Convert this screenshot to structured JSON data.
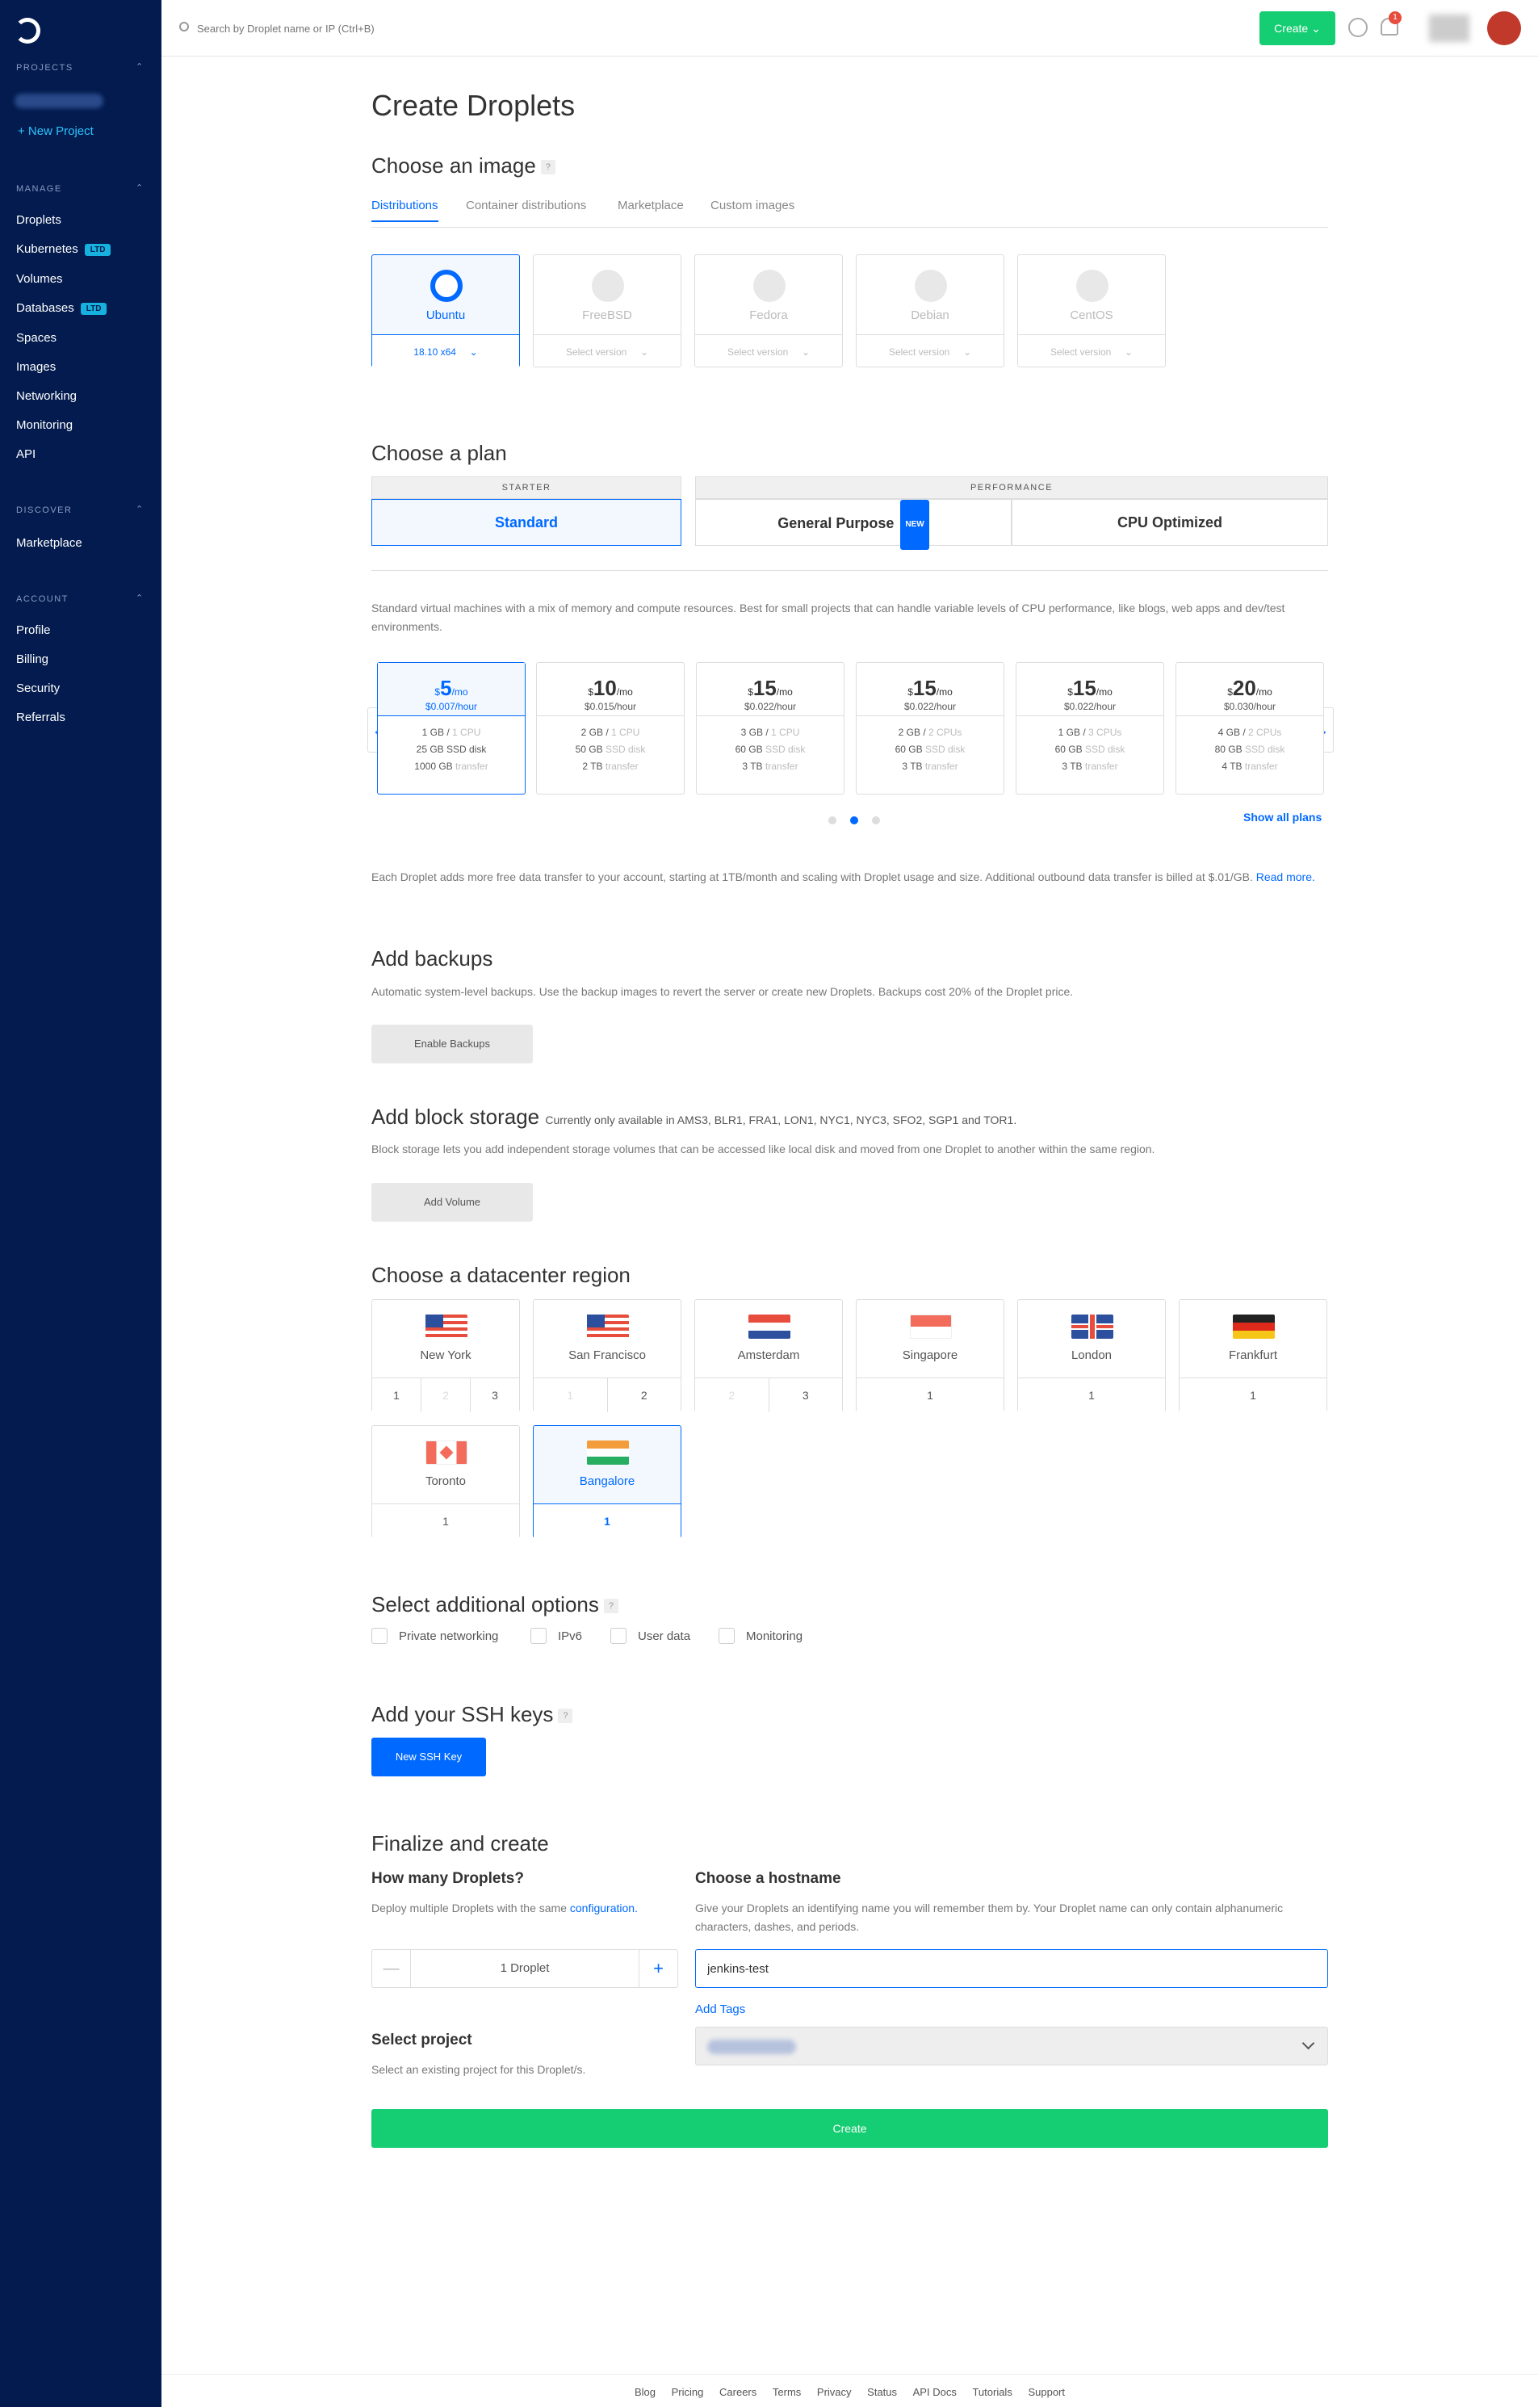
{
  "sidebar": {
    "projects_label": "PROJECTS",
    "new_project": "+  New Project",
    "manage_label": "MANAGE",
    "manage_items": [
      {
        "label": "Droplets",
        "badge": ""
      },
      {
        "label": "Kubernetes",
        "badge": "LTD"
      },
      {
        "label": "Volumes",
        "badge": ""
      },
      {
        "label": "Databases",
        "badge": "LTD"
      },
      {
        "label": "Spaces",
        "badge": ""
      },
      {
        "label": "Images",
        "badge": ""
      },
      {
        "label": "Networking",
        "badge": ""
      },
      {
        "label": "Monitoring",
        "badge": ""
      },
      {
        "label": "API",
        "badge": ""
      }
    ],
    "discover_label": "DISCOVER",
    "discover_items": [
      "Marketplace"
    ],
    "account_label": "ACCOUNT",
    "account_items": [
      "Profile",
      "Billing",
      "Security",
      "Referrals"
    ]
  },
  "topbar": {
    "search_placeholder": "Search by Droplet name or IP (Ctrl+B)",
    "create_label": "Create",
    "notification_count": "1"
  },
  "page_title": "Create Droplets",
  "image_section": {
    "title": "Choose an image",
    "help": "?",
    "tabs": [
      "Distributions",
      "Container distributions",
      "Marketplace",
      "Custom images"
    ],
    "distros": [
      {
        "name": "Ubuntu",
        "version": "18.10 x64"
      },
      {
        "name": "FreeBSD",
        "version": "Select version"
      },
      {
        "name": "Fedora",
        "version": "Select version"
      },
      {
        "name": "Debian",
        "version": "Select version"
      },
      {
        "name": "CentOS",
        "version": "Select version"
      }
    ]
  },
  "plan_section": {
    "title": "Choose a plan",
    "starter_label": "STARTER",
    "performance_label": "PERFORMANCE",
    "standard": "Standard",
    "general_purpose": "General Purpose",
    "new_badge": "NEW",
    "cpu_optimized": "CPU Optimized",
    "description": "Standard virtual machines with a mix of memory and compute resources. Best for small projects that can handle variable levels of CPU performance, like blogs, web apps and dev/test environments.",
    "plans": [
      {
        "price": "5",
        "hourly": "$0.007/hour",
        "mem": "1 GB",
        "cpu": "1 CPU",
        "disk": "25 GB",
        "transfer": "1000 GB"
      },
      {
        "price": "10",
        "hourly": "$0.015/hour",
        "mem": "2 GB",
        "cpu": "1 CPU",
        "disk": "50 GB",
        "transfer": "2 TB"
      },
      {
        "price": "15",
        "hourly": "$0.022/hour",
        "mem": "3 GB",
        "cpu": "1 CPU",
        "disk": "60 GB",
        "transfer": "3 TB"
      },
      {
        "price": "15",
        "hourly": "$0.022/hour",
        "mem": "2 GB",
        "cpu": "2 CPUs",
        "disk": "60 GB",
        "transfer": "3 TB"
      },
      {
        "price": "15",
        "hourly": "$0.022/hour",
        "mem": "1 GB",
        "cpu": "3 CPUs",
        "disk": "60 GB",
        "transfer": "3 TB"
      },
      {
        "price": "20",
        "hourly": "$0.030/hour",
        "mem": "4 GB",
        "cpu": "2 CPUs",
        "disk": "80 GB",
        "transfer": "4 TB"
      }
    ],
    "show_all": "Show all plans",
    "transfer_note": "Each Droplet adds more free data transfer to your account, starting at 1TB/month and scaling with Droplet usage and size. Additional outbound data transfer is billed at $.01/GB.",
    "read_more": "Read more."
  },
  "backups": {
    "title": "Add backups",
    "description": "Automatic system-level backups. Use the backup images to revert the server or create new Droplets. Backups cost 20% of the Droplet price.",
    "button": "Enable Backups"
  },
  "block_storage": {
    "title": "Add block storage",
    "availability": "Currently only available in AMS3, BLR1, FRA1, LON1, NYC1, NYC3, SFO2, SGP1 and TOR1.",
    "description": "Block storage lets you add independent storage volumes that can be accessed like local disk and moved from one Droplet to another within the same region.",
    "button": "Add Volume"
  },
  "datacenter": {
    "title": "Choose a datacenter region",
    "regions": [
      {
        "name": "New York",
        "nums": [
          "1",
          "2",
          "3"
        ]
      },
      {
        "name": "San Francisco",
        "nums": [
          "1",
          "2"
        ]
      },
      {
        "name": "Amsterdam",
        "nums": [
          "2",
          "3"
        ]
      },
      {
        "name": "Singapore",
        "nums": [
          "1"
        ]
      },
      {
        "name": "London",
        "nums": [
          "1"
        ]
      },
      {
        "name": "Frankfurt",
        "nums": [
          "1"
        ]
      },
      {
        "name": "Toronto",
        "nums": [
          "1"
        ]
      },
      {
        "name": "Bangalore",
        "nums": [
          "1"
        ]
      }
    ]
  },
  "options": {
    "title": "Select additional options",
    "help": "?",
    "items": [
      "Private networking",
      "IPv6",
      "User data",
      "Monitoring"
    ]
  },
  "ssh": {
    "title": "Add your SSH keys",
    "help": "?",
    "button": "New SSH Key"
  },
  "finalize": {
    "title": "Finalize and create",
    "how_many_title": "How many Droplets?",
    "how_many_desc": "Deploy multiple Droplets with the same",
    "configuration_link": "configuration.",
    "count": "1  Droplet",
    "hostname_title": "Choose a hostname",
    "hostname_desc": "Give your Droplets an identifying name you will remember them by. Your Droplet name can only contain alphanumeric characters, dashes, and periods.",
    "hostname_value": "jenkins-test",
    "add_tags": "Add Tags",
    "project_title": "Select project",
    "project_desc": "Select an existing project for this Droplet/s.",
    "create_button": "Create"
  },
  "footer": [
    "Blog",
    "Pricing",
    "Careers",
    "Terms",
    "Privacy",
    "Status",
    "API Docs",
    "Tutorials",
    "Support"
  ],
  "colors": {
    "accent": "#0069ff",
    "success": "#15cd72",
    "sidebar": "#031b4e"
  }
}
